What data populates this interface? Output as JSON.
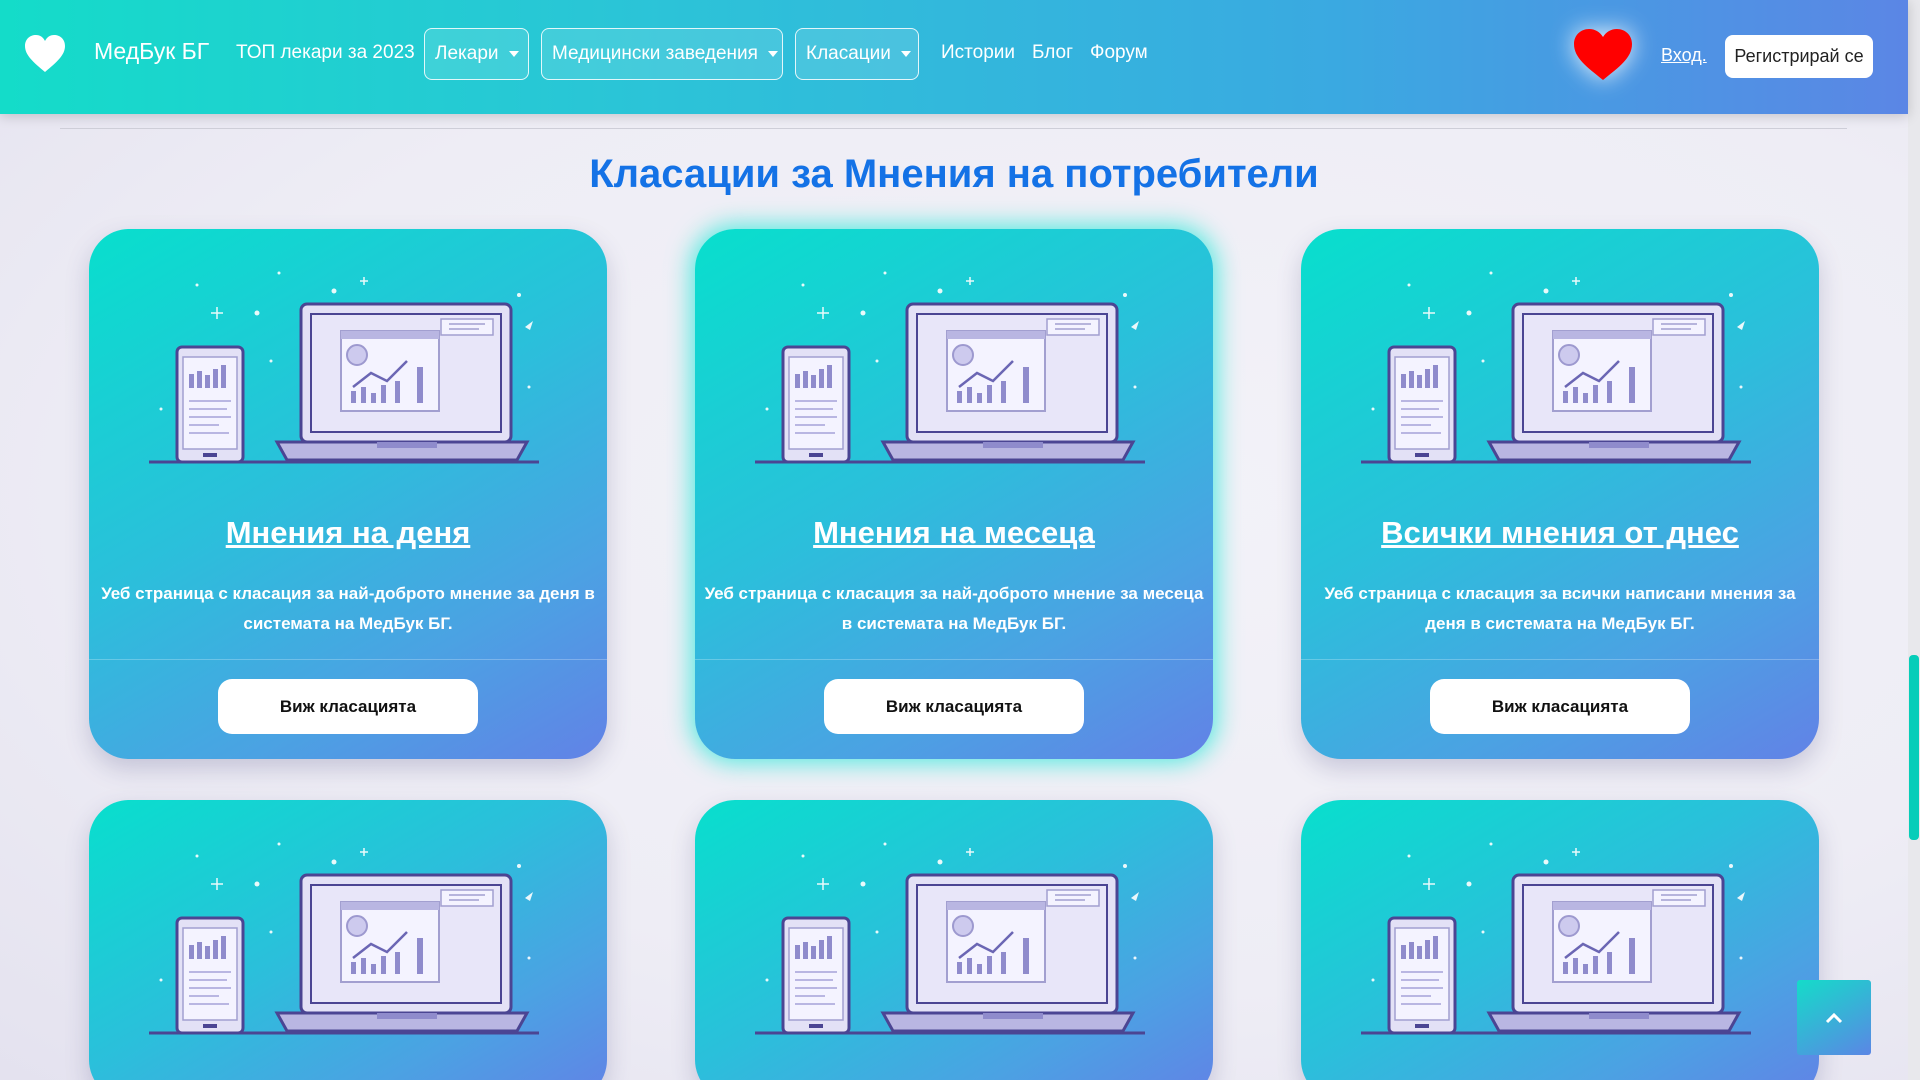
{
  "header": {
    "brand": "МедБук БГ",
    "top_link": "ТОП лекари за 2023",
    "dropdowns": [
      {
        "label": "Лекари"
      },
      {
        "label": "Медицински заведения"
      },
      {
        "label": "Класации"
      }
    ],
    "links": [
      "Истории",
      "Блог",
      "Форум"
    ],
    "login": "Вход.",
    "register": "Регистрирай се"
  },
  "section": {
    "title": "Класации за Мнения на потребители"
  },
  "cards": [
    {
      "title": "Мнения на деня",
      "description": "Уеб страница с класация за най-доброто мнение за деня в системата на МедБук БГ.",
      "button": "Виж класацията"
    },
    {
      "title": "Мнения на месеца",
      "description": "Уеб страница с класация за най-доброто мнение за месеца в системата на МедБук БГ.",
      "button": "Виж класацията"
    },
    {
      "title": "Всички мнения от днес",
      "description": "Уеб страница с класация за всички написани мнения за деня в системата на МедБук БГ.",
      "button": "Виж класацията"
    }
  ],
  "colors": {
    "accent": "#1472e6",
    "gradient_start": "#14dcc9",
    "gradient_end": "#5b86e5",
    "heart": "#ff0000"
  },
  "icons": {
    "brand": "heart-icon",
    "favorites": "heart-icon",
    "back_to_top": "chevron-up-icon"
  }
}
